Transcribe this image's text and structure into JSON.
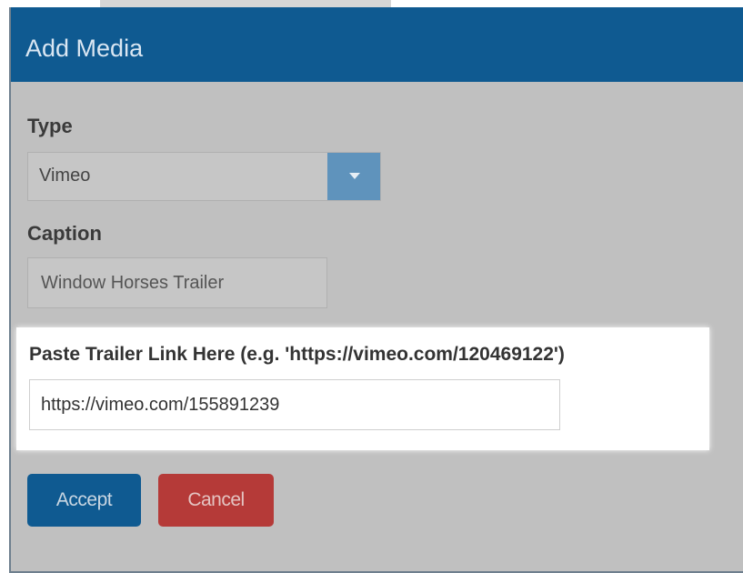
{
  "dialog": {
    "title": "Add Media"
  },
  "type_field": {
    "label": "Type",
    "selected_value": "Vimeo"
  },
  "caption_field": {
    "label": "Caption",
    "value": "Window Horses Trailer"
  },
  "link_field": {
    "label": "Paste Trailer Link Here (e.g. 'https://vimeo.com/120469122')",
    "value": "https://vimeo.com/155891239"
  },
  "actions": {
    "accept_label": "Accept",
    "cancel_label": "Cancel"
  },
  "colors": {
    "header": "#0f5a91",
    "accept": "#0f5a91",
    "cancel": "#b53a38",
    "select_arrow": "#5f93bc"
  },
  "icons": {
    "select_arrow": "chevron-down-icon"
  }
}
